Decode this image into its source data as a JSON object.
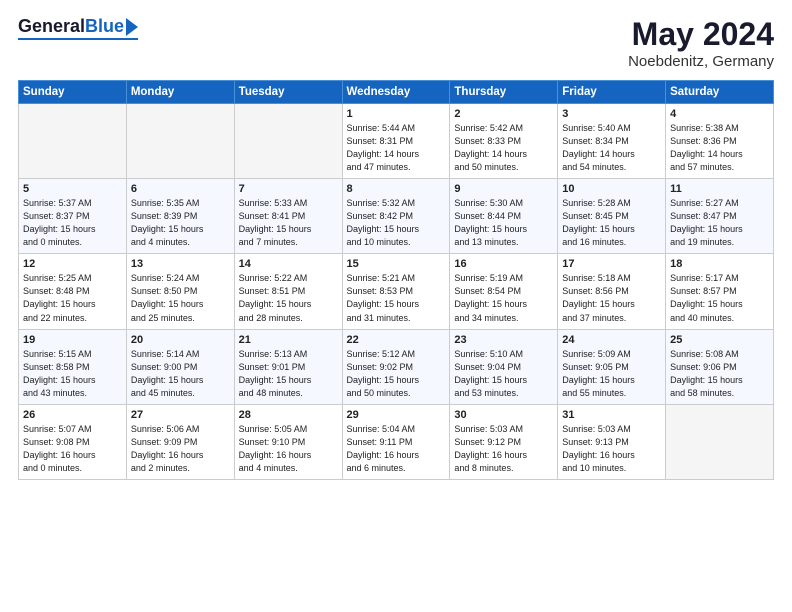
{
  "header": {
    "logo_general": "General",
    "logo_blue": "Blue",
    "title": "May 2024",
    "location": "Noebdenitz, Germany"
  },
  "days_of_week": [
    "Sunday",
    "Monday",
    "Tuesday",
    "Wednesday",
    "Thursday",
    "Friday",
    "Saturday"
  ],
  "weeks": [
    [
      {
        "day": "",
        "info": ""
      },
      {
        "day": "",
        "info": ""
      },
      {
        "day": "",
        "info": ""
      },
      {
        "day": "1",
        "info": "Sunrise: 5:44 AM\nSunset: 8:31 PM\nDaylight: 14 hours\nand 47 minutes."
      },
      {
        "day": "2",
        "info": "Sunrise: 5:42 AM\nSunset: 8:33 PM\nDaylight: 14 hours\nand 50 minutes."
      },
      {
        "day": "3",
        "info": "Sunrise: 5:40 AM\nSunset: 8:34 PM\nDaylight: 14 hours\nand 54 minutes."
      },
      {
        "day": "4",
        "info": "Sunrise: 5:38 AM\nSunset: 8:36 PM\nDaylight: 14 hours\nand 57 minutes."
      }
    ],
    [
      {
        "day": "5",
        "info": "Sunrise: 5:37 AM\nSunset: 8:37 PM\nDaylight: 15 hours\nand 0 minutes."
      },
      {
        "day": "6",
        "info": "Sunrise: 5:35 AM\nSunset: 8:39 PM\nDaylight: 15 hours\nand 4 minutes."
      },
      {
        "day": "7",
        "info": "Sunrise: 5:33 AM\nSunset: 8:41 PM\nDaylight: 15 hours\nand 7 minutes."
      },
      {
        "day": "8",
        "info": "Sunrise: 5:32 AM\nSunset: 8:42 PM\nDaylight: 15 hours\nand 10 minutes."
      },
      {
        "day": "9",
        "info": "Sunrise: 5:30 AM\nSunset: 8:44 PM\nDaylight: 15 hours\nand 13 minutes."
      },
      {
        "day": "10",
        "info": "Sunrise: 5:28 AM\nSunset: 8:45 PM\nDaylight: 15 hours\nand 16 minutes."
      },
      {
        "day": "11",
        "info": "Sunrise: 5:27 AM\nSunset: 8:47 PM\nDaylight: 15 hours\nand 19 minutes."
      }
    ],
    [
      {
        "day": "12",
        "info": "Sunrise: 5:25 AM\nSunset: 8:48 PM\nDaylight: 15 hours\nand 22 minutes."
      },
      {
        "day": "13",
        "info": "Sunrise: 5:24 AM\nSunset: 8:50 PM\nDaylight: 15 hours\nand 25 minutes."
      },
      {
        "day": "14",
        "info": "Sunrise: 5:22 AM\nSunset: 8:51 PM\nDaylight: 15 hours\nand 28 minutes."
      },
      {
        "day": "15",
        "info": "Sunrise: 5:21 AM\nSunset: 8:53 PM\nDaylight: 15 hours\nand 31 minutes."
      },
      {
        "day": "16",
        "info": "Sunrise: 5:19 AM\nSunset: 8:54 PM\nDaylight: 15 hours\nand 34 minutes."
      },
      {
        "day": "17",
        "info": "Sunrise: 5:18 AM\nSunset: 8:56 PM\nDaylight: 15 hours\nand 37 minutes."
      },
      {
        "day": "18",
        "info": "Sunrise: 5:17 AM\nSunset: 8:57 PM\nDaylight: 15 hours\nand 40 minutes."
      }
    ],
    [
      {
        "day": "19",
        "info": "Sunrise: 5:15 AM\nSunset: 8:58 PM\nDaylight: 15 hours\nand 43 minutes."
      },
      {
        "day": "20",
        "info": "Sunrise: 5:14 AM\nSunset: 9:00 PM\nDaylight: 15 hours\nand 45 minutes."
      },
      {
        "day": "21",
        "info": "Sunrise: 5:13 AM\nSunset: 9:01 PM\nDaylight: 15 hours\nand 48 minutes."
      },
      {
        "day": "22",
        "info": "Sunrise: 5:12 AM\nSunset: 9:02 PM\nDaylight: 15 hours\nand 50 minutes."
      },
      {
        "day": "23",
        "info": "Sunrise: 5:10 AM\nSunset: 9:04 PM\nDaylight: 15 hours\nand 53 minutes."
      },
      {
        "day": "24",
        "info": "Sunrise: 5:09 AM\nSunset: 9:05 PM\nDaylight: 15 hours\nand 55 minutes."
      },
      {
        "day": "25",
        "info": "Sunrise: 5:08 AM\nSunset: 9:06 PM\nDaylight: 15 hours\nand 58 minutes."
      }
    ],
    [
      {
        "day": "26",
        "info": "Sunrise: 5:07 AM\nSunset: 9:08 PM\nDaylight: 16 hours\nand 0 minutes."
      },
      {
        "day": "27",
        "info": "Sunrise: 5:06 AM\nSunset: 9:09 PM\nDaylight: 16 hours\nand 2 minutes."
      },
      {
        "day": "28",
        "info": "Sunrise: 5:05 AM\nSunset: 9:10 PM\nDaylight: 16 hours\nand 4 minutes."
      },
      {
        "day": "29",
        "info": "Sunrise: 5:04 AM\nSunset: 9:11 PM\nDaylight: 16 hours\nand 6 minutes."
      },
      {
        "day": "30",
        "info": "Sunrise: 5:03 AM\nSunset: 9:12 PM\nDaylight: 16 hours\nand 8 minutes."
      },
      {
        "day": "31",
        "info": "Sunrise: 5:03 AM\nSunset: 9:13 PM\nDaylight: 16 hours\nand 10 minutes."
      },
      {
        "day": "",
        "info": ""
      }
    ]
  ]
}
